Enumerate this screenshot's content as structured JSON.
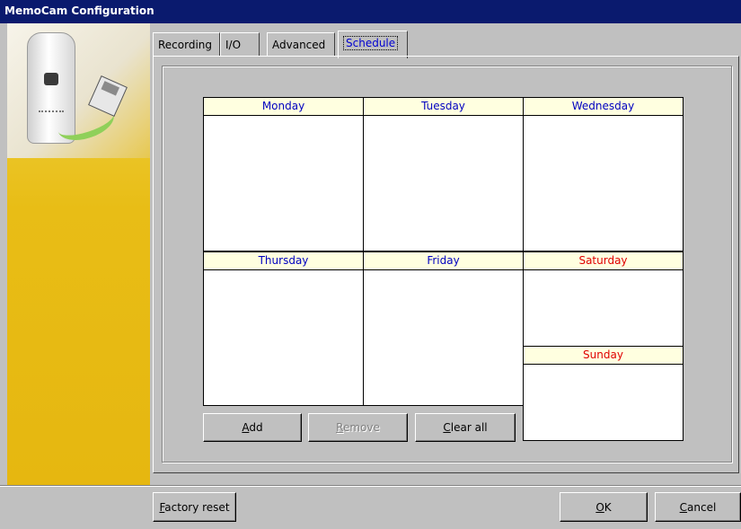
{
  "window": {
    "title": "MemoCam Configuration"
  },
  "tabs": [
    {
      "label": "Recording",
      "selected": false
    },
    {
      "label": "I/O",
      "selected": false
    },
    {
      "label": "Advanced",
      "selected": false
    },
    {
      "label": "Schedule",
      "selected": true
    }
  ],
  "schedule": {
    "days": [
      {
        "name": "Monday",
        "weekend": false
      },
      {
        "name": "Tuesday",
        "weekend": false
      },
      {
        "name": "Wednesday",
        "weekend": false
      },
      {
        "name": "Thursday",
        "weekend": false
      },
      {
        "name": "Friday",
        "weekend": false
      },
      {
        "name": "Saturday",
        "weekend": true
      },
      {
        "name": "Sunday",
        "weekend": true
      }
    ],
    "buttons": {
      "add": {
        "mnemonic": "A",
        "rest": "dd"
      },
      "remove": {
        "mnemonic": "R",
        "rest": "emove",
        "enabled": false
      },
      "clear_all": {
        "mnemonic": "C",
        "rest": "lear all"
      }
    }
  },
  "footer": {
    "factory_reset": {
      "mnemonic": "F",
      "rest": "actory reset"
    },
    "ok": {
      "mnemonic": "O",
      "rest": "K"
    },
    "cancel": {
      "mnemonic": "C",
      "rest": "ancel"
    }
  },
  "colors": {
    "title_bar": "#0a1a6e",
    "weekday_text": "#0000c0",
    "weekend_text": "#e00000",
    "header_bg": "#ffffe0",
    "sidebar_yellow": "#e6b710"
  }
}
